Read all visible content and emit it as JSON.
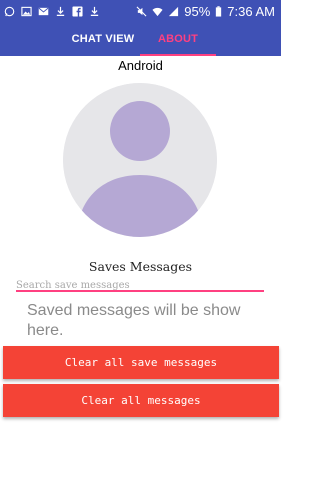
{
  "status_bar": {
    "left_icons": [
      "whatsapp-icon",
      "image-icon",
      "mail-icon",
      "download-icon",
      "facebook-icon",
      "download-icon"
    ],
    "right_icons": [
      "mute-icon",
      "wifi-icon",
      "signal-icon",
      "battery-icon"
    ],
    "battery": "95%",
    "time": "7:36 AM"
  },
  "tabs": [
    {
      "label": "CHAT VIEW",
      "active": false
    },
    {
      "label": "ABOUT",
      "active": true
    }
  ],
  "about": {
    "app_name": "Android",
    "avatar_icon": "user-avatar-icon",
    "section_title": "Saves Messages",
    "search_placeholder": "Search save messages",
    "search_value": "",
    "empty_message": "Saved messages will be show here."
  },
  "buttons": {
    "clear_saved": "Clear all save messages",
    "clear_all": "Clear all messages"
  },
  "colors": {
    "primary": "#3f51b5",
    "accent": "#ff4081",
    "button": "#f44336",
    "avatar_bg": "#e6e6e9",
    "avatar_figure": "#b5a8d4"
  }
}
